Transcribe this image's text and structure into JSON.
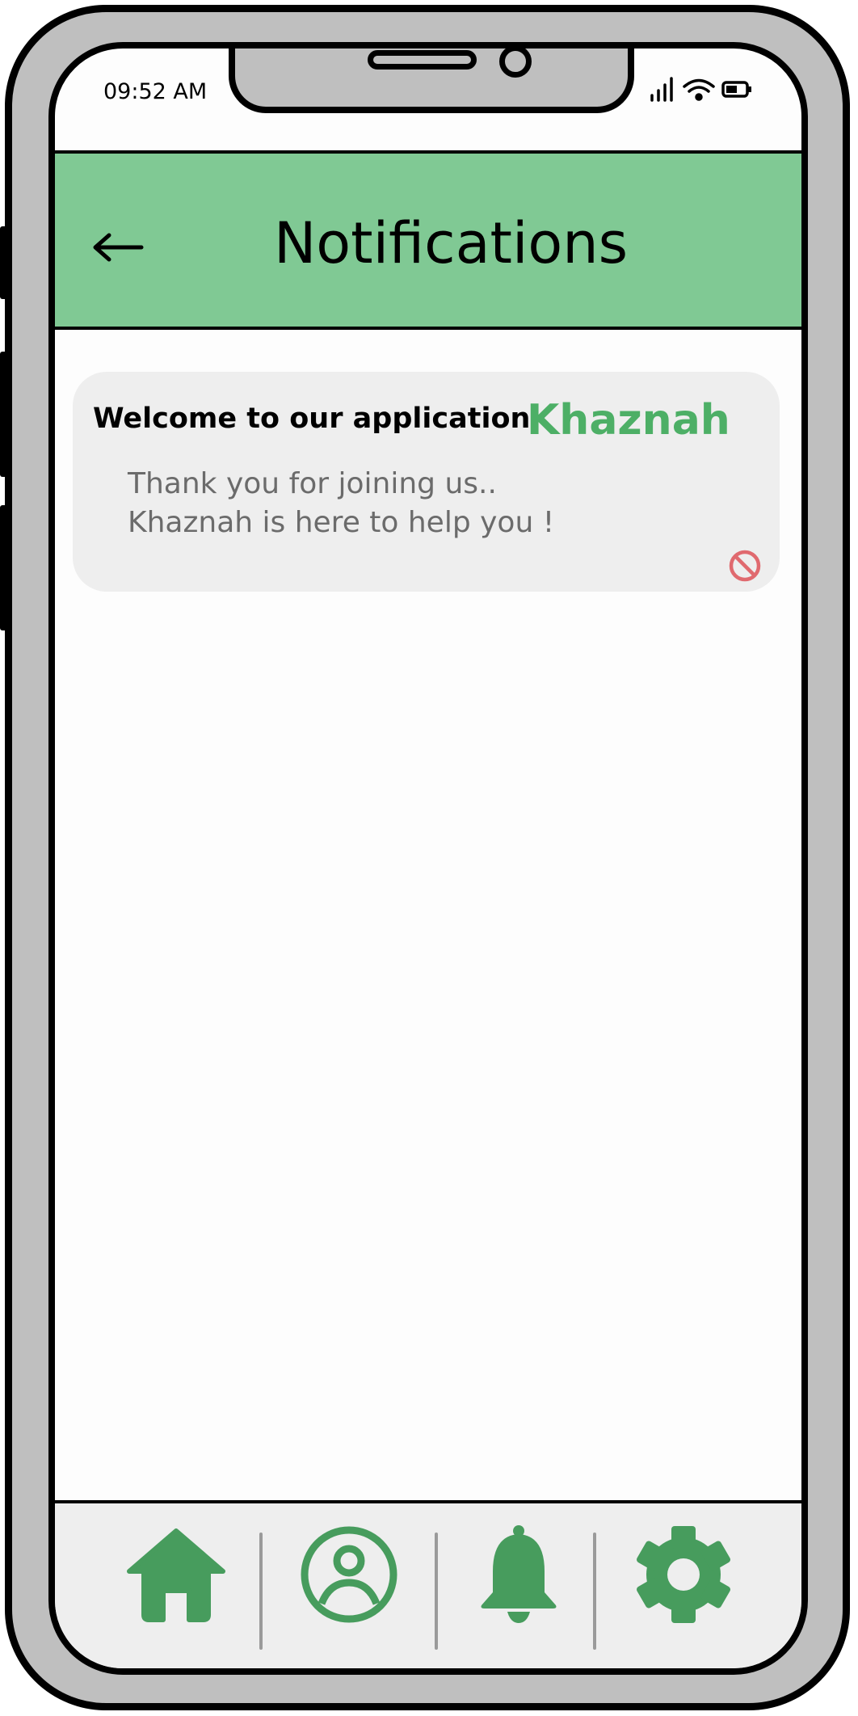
{
  "status_bar": {
    "time": "09:52 AM",
    "icons": [
      "signal-icon",
      "wifi-icon",
      "battery-icon"
    ]
  },
  "header": {
    "title": "Notifications",
    "back_icon": "arrow-left-icon"
  },
  "notifications": [
    {
      "title": "Welcome to our application",
      "brand": "Khaznah",
      "body_line_1": "Thank you for joining us..",
      "body_line_2": "Khaznah is here to help you !",
      "dismiss_icon": "prohibited-icon"
    }
  ],
  "bottom_nav": {
    "items": [
      {
        "icon": "home-icon"
      },
      {
        "icon": "profile-icon"
      },
      {
        "icon": "bell-icon"
      },
      {
        "icon": "gear-icon"
      }
    ]
  },
  "colors": {
    "header_bg": "#80c994",
    "brand_green": "#4daf66",
    "nav_green": "#479c5d",
    "dismiss_red": "#e06a6f",
    "card_bg": "#eeeeee",
    "frame_gray": "#bfbfbf"
  }
}
